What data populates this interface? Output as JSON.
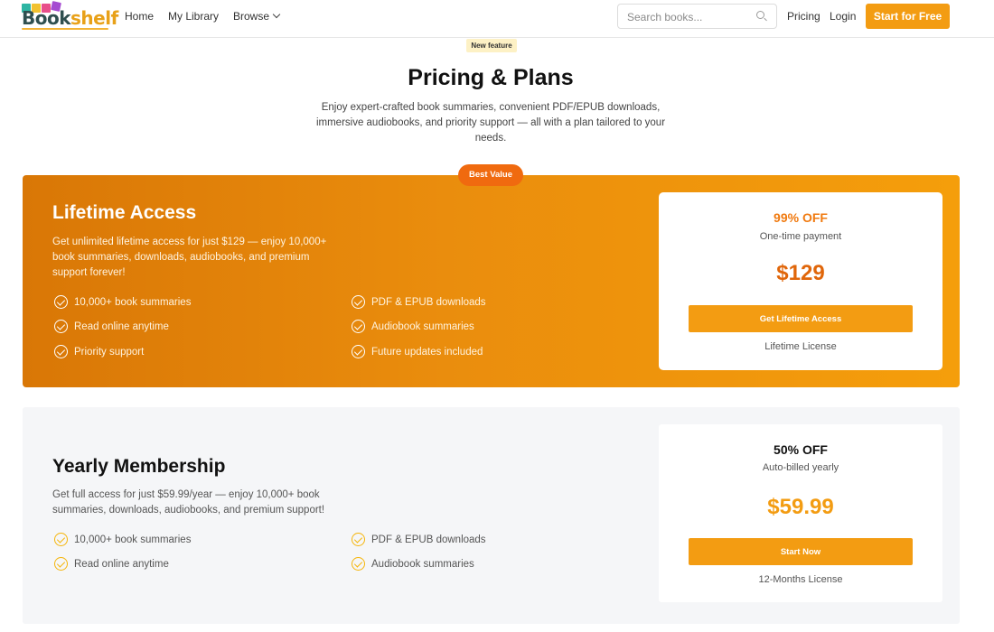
{
  "nav": {
    "logo": "Bookshelf",
    "links": {
      "home": "Home",
      "library": "My Library",
      "browse": "Browse",
      "pricing": "Pricing",
      "login": "Login"
    },
    "search_placeholder": "Search books...",
    "cta": "Start for Free"
  },
  "hero": {
    "badge": "New feature",
    "title": "Pricing & Plans",
    "subtitle": "Enjoy expert-crafted book summaries, convenient PDF/EPUB downloads, immersive audiobooks, and priority support — all with a plan tailored to your needs."
  },
  "lifetime": {
    "badge": "Best Value",
    "title": "Lifetime Access",
    "description": "Get unlimited lifetime access for just $129 — enjoy 10,000+ book summaries, downloads, audiobooks, and premium support forever!",
    "features": [
      "10,000+ book summaries",
      "PDF & EPUB downloads",
      "Read online anytime",
      "Audiobook summaries",
      "Priority support",
      "Future updates included"
    ],
    "discount": "99% OFF",
    "payment_note": "One-time payment",
    "price": "$129",
    "button": "Get Lifetime Access",
    "license": "Lifetime License"
  },
  "yearly": {
    "title": "Yearly Membership",
    "description": "Get full access for just $59.99/year — enjoy 10,000+ book summaries, downloads, audiobooks, and premium support!",
    "features": [
      "10,000+ book summaries",
      "PDF & EPUB downloads",
      "Read online anytime",
      "Audiobook summaries"
    ],
    "discount": "50% OFF",
    "payment_note": "Auto-billed yearly",
    "price": "$59.99",
    "button": "Start Now",
    "license": "12-Months License"
  },
  "colors": {
    "accent": "#f39c12",
    "lifetime_gradient_start": "#d97706",
    "lifetime_gradient_end": "#f59e0b",
    "best_value_badge": "#f06a0f",
    "lifetime_discount_text": "#f07a10",
    "lifetime_price": "#e0660a",
    "yearly_price": "#f39c12"
  }
}
